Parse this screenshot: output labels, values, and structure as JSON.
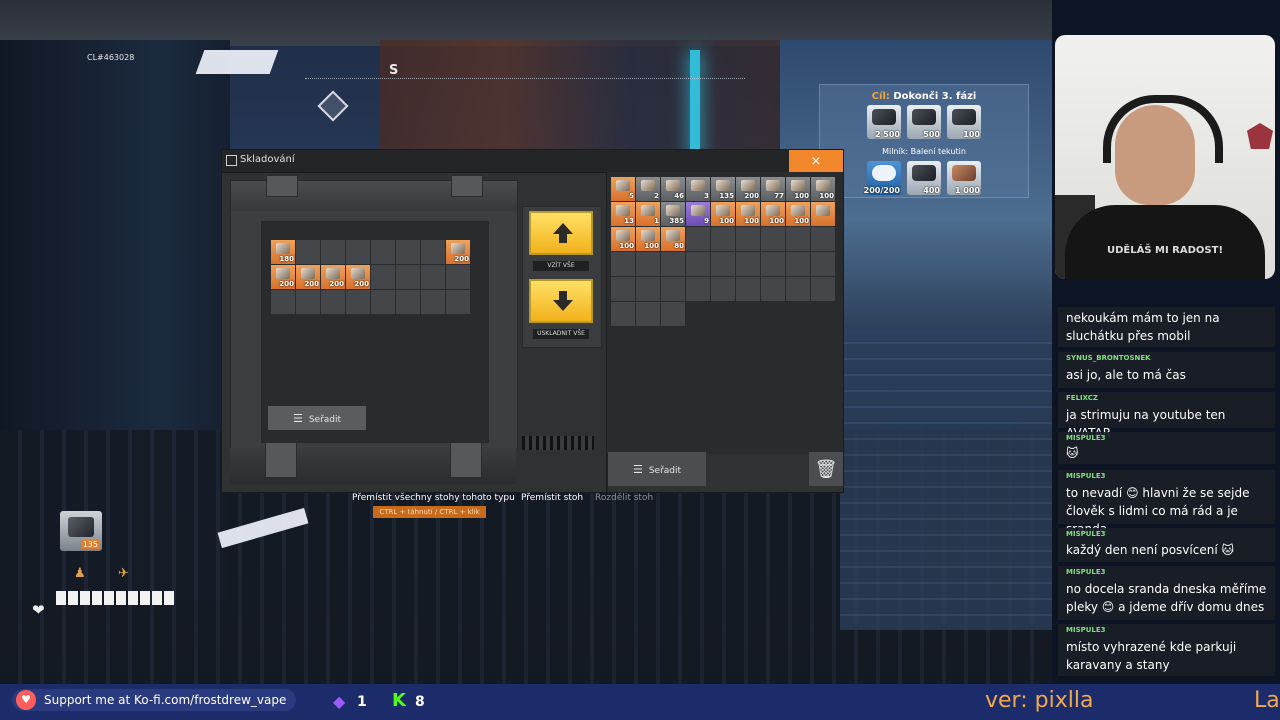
{
  "hud": {
    "coordinate": "CL#463028",
    "compass_heading": "S"
  },
  "objective": {
    "title_prefix": "Cíl:",
    "title": "Dokonči 3. fázi",
    "items": [
      {
        "icon": "cable-spool-icon",
        "qty": "2 500"
      },
      {
        "icon": "engine-block-icon",
        "qty": "500"
      },
      {
        "icon": "gear-coil-icon",
        "qty": "100"
      }
    ],
    "milestone_label": "Milník: Balení tekutin",
    "milestone_items": [
      {
        "icon": "gauge-icon",
        "qty": "200/200",
        "done": true
      },
      {
        "icon": "battery-icon",
        "qty": "400",
        "done": false
      },
      {
        "icon": "pipe-icon",
        "qty": "1 000",
        "done": false
      }
    ]
  },
  "storage": {
    "title": "Skladování",
    "close_label": "×",
    "take_all_label": "VZÍT VŠE",
    "store_all_label": "USKLADNIT VŠE",
    "sort_label": "Seřadit",
    "left_slots": [
      {
        "qty": "180",
        "style": "filled"
      },
      {
        "qty": "",
        "style": "empty"
      },
      {
        "qty": "",
        "style": "empty"
      },
      {
        "qty": "",
        "style": "empty"
      },
      {
        "qty": "",
        "style": "empty"
      },
      {
        "qty": "",
        "style": "empty"
      },
      {
        "qty": "",
        "style": "empty"
      },
      {
        "qty": "200",
        "style": "filled"
      },
      {
        "qty": "200",
        "style": "filled"
      },
      {
        "qty": "200",
        "style": "filled"
      },
      {
        "qty": "200",
        "style": "filled"
      },
      {
        "qty": "200",
        "style": "filled"
      },
      {
        "qty": "",
        "style": "empty"
      },
      {
        "qty": "",
        "style": "empty"
      },
      {
        "qty": "",
        "style": "empty"
      },
      {
        "qty": "",
        "style": "empty"
      },
      {
        "qty": "",
        "style": "empty"
      },
      {
        "qty": "",
        "style": "empty"
      },
      {
        "qty": "",
        "style": "empty"
      },
      {
        "qty": "",
        "style": "empty"
      },
      {
        "qty": "",
        "style": "empty"
      },
      {
        "qty": "",
        "style": "empty"
      },
      {
        "qty": "",
        "style": "empty"
      },
      {
        "qty": "",
        "style": "empty"
      }
    ],
    "right_slots": [
      {
        "qty": "5",
        "style": "filled"
      },
      {
        "qty": "2",
        "style": "grey"
      },
      {
        "qty": "46",
        "style": "grey"
      },
      {
        "qty": "3",
        "style": "grey"
      },
      {
        "qty": "135",
        "style": "grey"
      },
      {
        "qty": "200",
        "style": "grey"
      },
      {
        "qty": "77",
        "style": "grey"
      },
      {
        "qty": "100",
        "style": "grey"
      },
      {
        "qty": "100",
        "style": "grey"
      },
      {
        "qty": "13",
        "style": "filled"
      },
      {
        "qty": "1",
        "style": "filled"
      },
      {
        "qty": "385",
        "style": "grey"
      },
      {
        "qty": "9",
        "style": "purple"
      },
      {
        "qty": "100",
        "style": "filled"
      },
      {
        "qty": "100",
        "style": "filled"
      },
      {
        "qty": "100",
        "style": "filled"
      },
      {
        "qty": "100",
        "style": "filled"
      },
      {
        "qty": "",
        "style": "filled"
      },
      {
        "qty": "100",
        "style": "filled"
      },
      {
        "qty": "100",
        "style": "filled"
      },
      {
        "qty": "80",
        "style": "filled"
      },
      {
        "qty": "",
        "style": "empty"
      },
      {
        "qty": "",
        "style": "empty"
      },
      {
        "qty": "",
        "style": "empty"
      },
      {
        "qty": "",
        "style": "empty"
      },
      {
        "qty": "",
        "style": "empty"
      },
      {
        "qty": "",
        "style": "empty"
      },
      {
        "qty": "",
        "style": "empty"
      },
      {
        "qty": "",
        "style": "empty"
      },
      {
        "qty": "",
        "style": "empty"
      },
      {
        "qty": "",
        "style": "empty"
      },
      {
        "qty": "",
        "style": "empty"
      },
      {
        "qty": "",
        "style": "empty"
      },
      {
        "qty": "",
        "style": "empty"
      },
      {
        "qty": "",
        "style": "empty"
      },
      {
        "qty": "",
        "style": "empty"
      },
      {
        "qty": "",
        "style": "empty"
      },
      {
        "qty": "",
        "style": "empty"
      },
      {
        "qty": "",
        "style": "empty"
      },
      {
        "qty": "",
        "style": "empty"
      },
      {
        "qty": "",
        "style": "empty"
      },
      {
        "qty": "",
        "style": "empty"
      },
      {
        "qty": "",
        "style": "empty"
      },
      {
        "qty": "",
        "style": "empty"
      },
      {
        "qty": "",
        "style": "empty"
      },
      {
        "qty": "",
        "style": "empty"
      },
      {
        "qty": "",
        "style": "empty"
      },
      {
        "qty": "",
        "style": "empty"
      }
    ]
  },
  "hints": {
    "move_all_of_type": "Přemístit všechny stohy tohoto typu",
    "move_all_of_type_keys": "CTRL + táhnutí / CTRL + klik",
    "move_stack": "Přemístit stoh",
    "split_stack": "Rozdělit stoh"
  },
  "hotbar": {
    "selected_qty": "135",
    "health_segments": 10
  },
  "webcam": {
    "shirt_text": "UDĚLÁŠ MI RADOST!"
  },
  "chat": [
    {
      "user": "",
      "text": "nekoukám mám to jen na sluchátku přes mobil"
    },
    {
      "user": "SYNUS_BRONTOSNEK",
      "text": "asi jo, ale to má čas"
    },
    {
      "user": "FELIXCZ",
      "text": "ja strimuju na youtube ten AVATAR"
    },
    {
      "user": "MISPULE3",
      "text": "🐱"
    },
    {
      "user": "MISPULE3",
      "text": "to nevadí 😊 hlavni že se sejde člověk s lidmi co má rád a je sranda"
    },
    {
      "user": "MISPULE3",
      "text": "každý den není posvícení 🐱"
    },
    {
      "user": "MISPULE3",
      "text": "no docela sranda dneska měříme pleky 😊 a jdeme dřív domu dnes"
    },
    {
      "user": "MISPULE3",
      "text": "místo vyhrazené kde parkuji karavany a stany"
    }
  ],
  "bottom_bar": {
    "kofi_text": "Support me at Ko-fi.com/frostdrew_vape",
    "sub_count": "1",
    "k_count": "8",
    "ticker_text": "ver: pixlla",
    "ticker_tail": "La"
  },
  "colors": {
    "accent_orange": "#f2882b",
    "gold_button": "#f2b21c",
    "bottom_bar": "#1c2c6a"
  }
}
